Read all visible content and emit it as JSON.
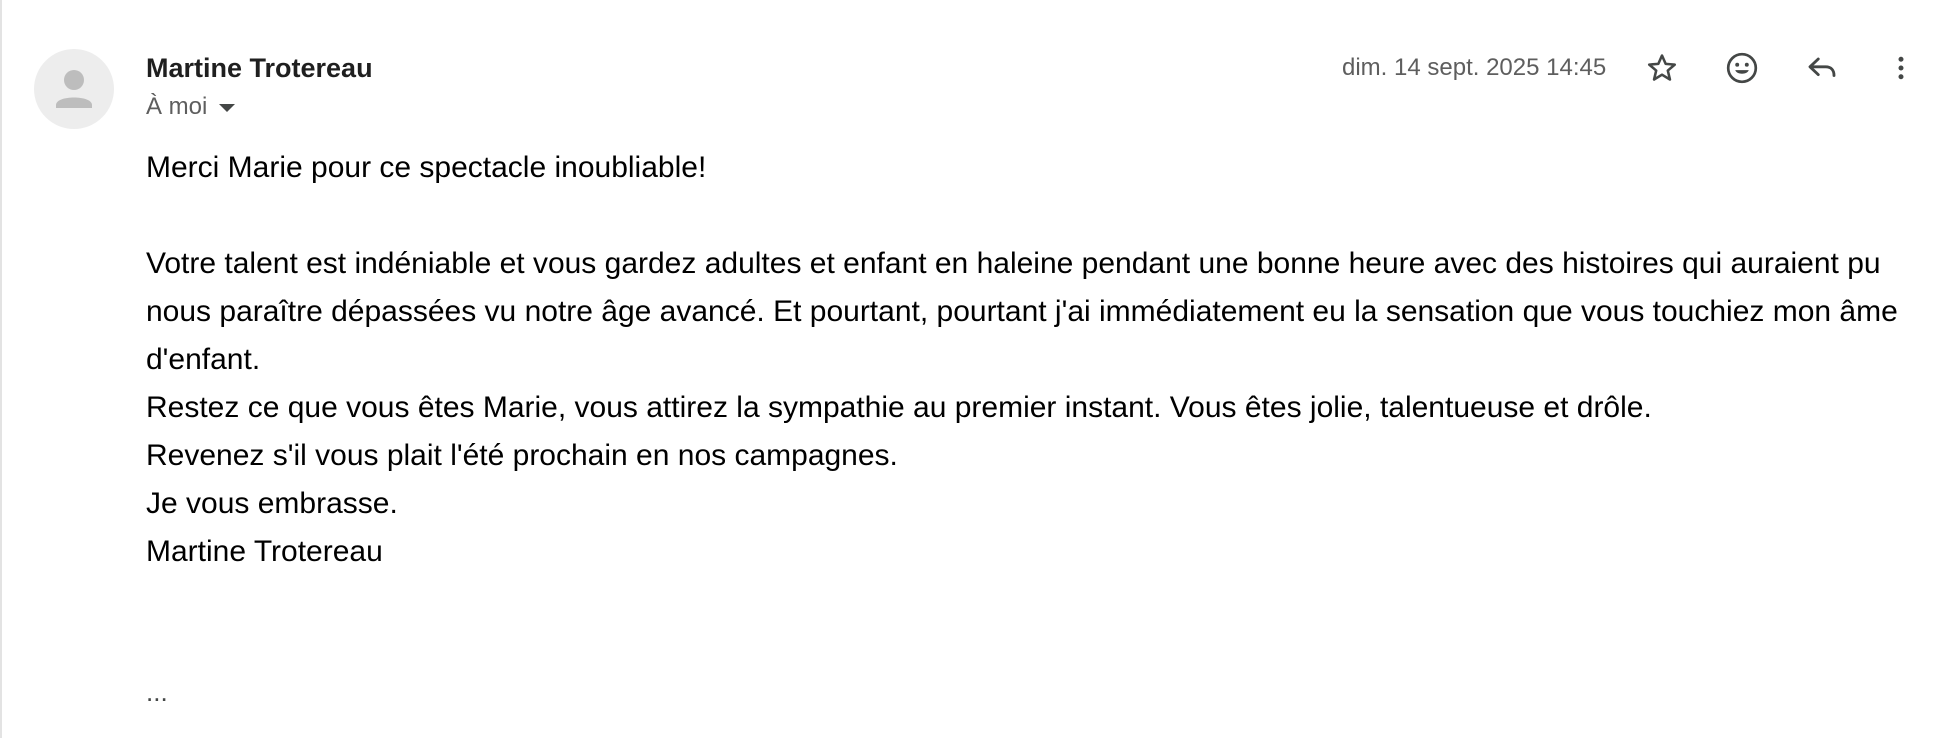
{
  "email": {
    "sender_name": "Martine Trotereau",
    "recipient_label": "À moi",
    "date": "dim. 14 sept. 2025 14:45",
    "body": {
      "greeting": "Merci Marie pour ce spectacle inoubliable!",
      "paragraph": "Votre talent est indéniable et vous gardez adultes et enfant en haleine pendant une bonne heure avec des histoires qui auraient pu nous paraître dépassées vu notre âge avancé. Et pourtant, pourtant j'ai immédiatement eu la sensation que vous touchiez mon âme d'enfant.",
      "line_1": "Restez ce que vous êtes Marie, vous attirez la sympathie au premier instant. Vous êtes jolie, talentueuse et drôle.",
      "line_2": "Revenez s'il vous plait l'été prochain en nos campagnes.",
      "line_3": "Je vous embrasse.",
      "signature": "Martine Trotereau"
    },
    "trimmed_content_label": "..."
  },
  "icons": {
    "avatar": "default-person-icon",
    "star": "star-outline-icon",
    "emoji": "add-reaction-icon",
    "reply": "reply-icon",
    "more": "more-vert-icon",
    "recipient_caret": "caret-down-icon"
  },
  "colors": {
    "text_primary": "#1f1f1f",
    "text_secondary": "#5e5e5e",
    "icon": "#444746",
    "avatar_bg": "#ededed",
    "avatar_fg": "#bdbdbd"
  }
}
